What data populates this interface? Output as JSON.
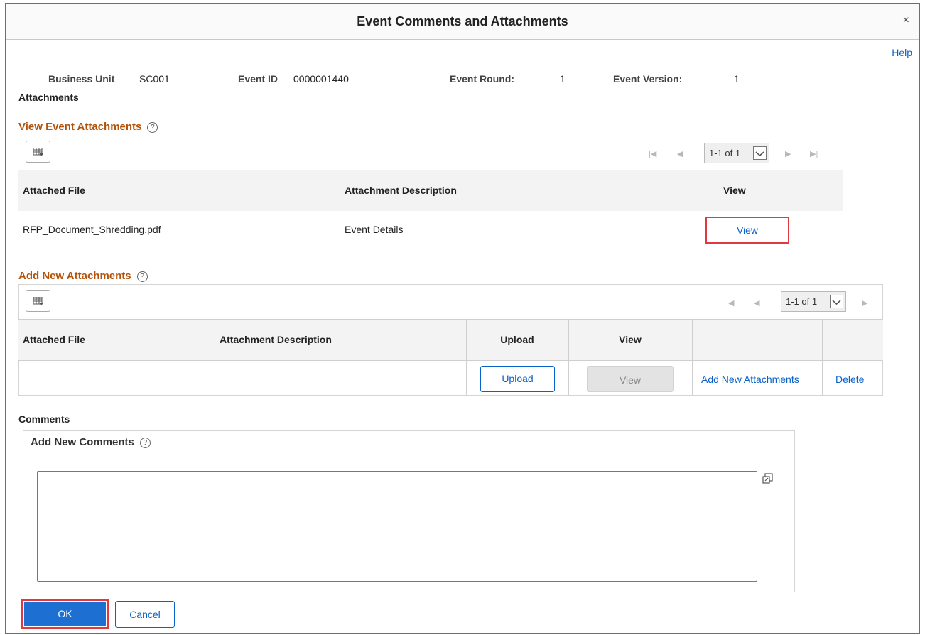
{
  "dialog": {
    "title": "Event Comments and Attachments",
    "close_glyph": "×",
    "help_label": "Help"
  },
  "info": {
    "business_unit_label": "Business Unit",
    "business_unit_value": "SC001",
    "event_id_label": "Event ID",
    "event_id_value": "0000001440",
    "event_round_label": "Event Round:",
    "event_round_value": "1",
    "event_version_label": "Event Version:",
    "event_version_value": "1"
  },
  "attachments_heading": "Attachments",
  "view_section": {
    "title": "View Event Attachments",
    "pager_text": "1-1 of 1",
    "columns": [
      "Attached File",
      "Attachment Description",
      "View"
    ],
    "rows": [
      {
        "file": "RFP_Document_Shredding.pdf",
        "description": "Event Details",
        "view_label": "View"
      }
    ]
  },
  "add_section": {
    "title": "Add New Attachments",
    "pager_text": "1-1 of 1",
    "columns": [
      "Attached File",
      "Attachment Description",
      "Upload",
      "View"
    ],
    "row": {
      "upload_label": "Upload",
      "view_label": "View",
      "add_link": "Add New Attachments",
      "delete_link": "Delete"
    }
  },
  "comments": {
    "heading": "Comments",
    "box_title": "Add New Comments",
    "text_value": ""
  },
  "footer": {
    "ok_label": "OK",
    "cancel_label": "Cancel"
  },
  "colors": {
    "link": "#0a62c9",
    "section_title": "#b45309",
    "ok_button": "#1d6fd1",
    "highlight_box": "#e0393e"
  }
}
